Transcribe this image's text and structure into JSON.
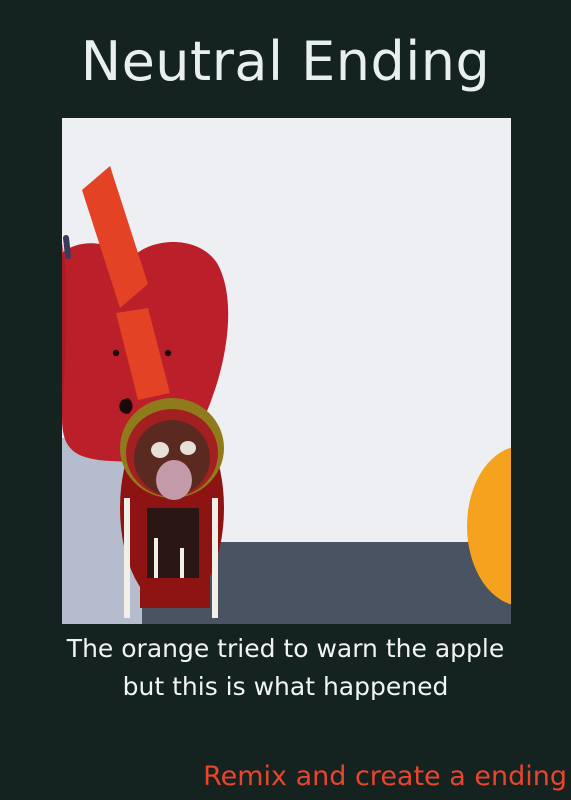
{
  "ending": {
    "title": "Neutral Ending",
    "caption_line_1": "The orange tried to warn the apple",
    "caption_line_2": "but this is what happened"
  },
  "actions": {
    "remix_label": "Remix and create a ending"
  },
  "scene": {
    "characters": [
      "apple-character",
      "orange-character",
      "monster-character"
    ]
  },
  "colors": {
    "background": "#142220",
    "title_text": "#e8efee",
    "remix_link": "#e8452c",
    "apple_red": "#bb1f2a",
    "orange": "#f5a21e",
    "stage_floor": "#4a5361",
    "stage_wall": "#eeeff2"
  }
}
